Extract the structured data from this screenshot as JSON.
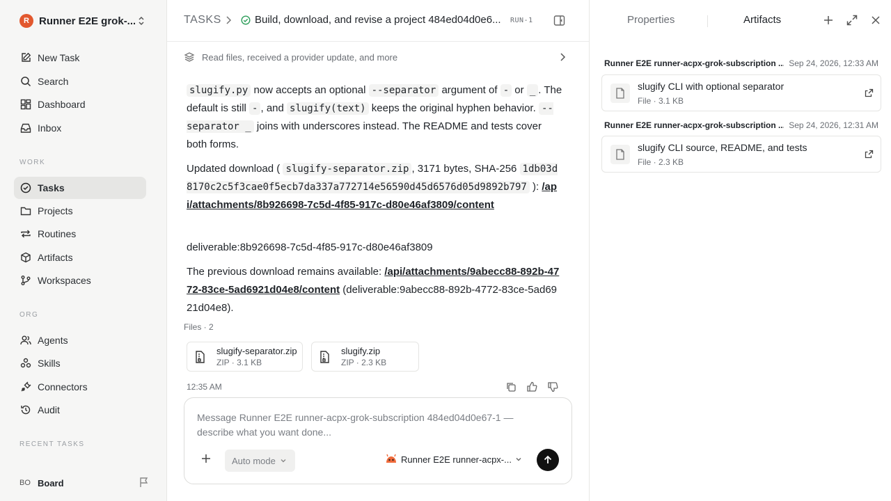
{
  "sidebar": {
    "workspace": {
      "initial": "R",
      "name": "Runner E2E grok-..."
    },
    "nav": [
      {
        "label": "New Task",
        "icon": "edit-icon"
      },
      {
        "label": "Search",
        "icon": "search-icon"
      },
      {
        "label": "Dashboard",
        "icon": "dashboard-icon"
      },
      {
        "label": "Inbox",
        "icon": "inbox-icon"
      }
    ],
    "work_label": "WORK",
    "work": [
      {
        "label": "Tasks",
        "icon": "check-circle-icon",
        "active": true
      },
      {
        "label": "Projects",
        "icon": "folder-icon"
      },
      {
        "label": "Routines",
        "icon": "repeat-icon"
      },
      {
        "label": "Artifacts",
        "icon": "cube-icon"
      },
      {
        "label": "Workspaces",
        "icon": "git-branch-icon"
      }
    ],
    "org_label": "ORG",
    "org": [
      {
        "label": "Agents",
        "icon": "users-icon"
      },
      {
        "label": "Skills",
        "icon": "skills-icon"
      },
      {
        "label": "Connectors",
        "icon": "plug-icon"
      },
      {
        "label": "Audit",
        "icon": "history-icon"
      }
    ],
    "recent_label": "RECENT TASKS",
    "board": {
      "avatar": "BO",
      "name": "Board"
    }
  },
  "header": {
    "root": "TASKS",
    "title": "Build, download, and revise a project 484ed04d0e6...",
    "run": "RUN-1"
  },
  "activity": {
    "text": "Read files, received a provider update, and more"
  },
  "message": {
    "p1": {
      "code1": "slugify.py",
      "t1": " now accepts an optional ",
      "code2": "--separator",
      "t2": " argument of ",
      "code3": "-",
      "t3": " or ",
      "code4": "_",
      "t4": ". The default is still ",
      "code5": "-",
      "t5": ", and ",
      "code6": "slugify(text)",
      "t6": " keeps the original hyphen behavior. ",
      "code7": "--separator _",
      "t7": " joins with underscores instead. The README and tests cover both forms."
    },
    "p2": {
      "t1": "Updated download ( ",
      "code1": "slugify-separator.zip",
      "t2": ", 3171 bytes, SHA-256 ",
      "code2": "1db03d8170c2c5f3cae0f5ecb7da337a772714e56590d45d6576d05d9892b797",
      "t3": " ): ",
      "link": "/api/attachments/8b926698-7c5d-4f85-917c-d80e46af3809/content"
    },
    "p3": "deliverable:8b926698-7c5d-4f85-917c-d80e46af3809",
    "p4": {
      "t1": "The previous download remains available: ",
      "link": "/api/attachments/9abecc88-892b-4772-83ce-5ad6921d04e8/content",
      "t2": " (deliverable:9abecc88-892b-4772-83ce-5ad6921d04e8)."
    },
    "files_label": "Files · 2",
    "files": [
      {
        "name": "slugify-separator.zip",
        "meta": "ZIP · 3.1 KB"
      },
      {
        "name": "slugify.zip",
        "meta": "ZIP · 2.3 KB"
      }
    ],
    "time": "12:35 AM"
  },
  "composer": {
    "placeholder": "Message Runner E2E runner-acpx-grok-subscription 484ed04d0e67-1 — describe what you want done...",
    "mode": "Auto mode",
    "agent": "Runner E2E runner-acpx-..."
  },
  "right_panel": {
    "tabs": {
      "properties": "Properties",
      "artifacts": "Artifacts"
    },
    "groups": [
      {
        "name": "Runner E2E runner-acpx-grok-subscription ...",
        "date": "Sep 24, 2026, 12:33 AM",
        "artifact": {
          "title": "slugify CLI with optional separator",
          "meta": "File · 3.1 KB"
        }
      },
      {
        "name": "Runner E2E runner-acpx-grok-subscription ...",
        "date": "Sep 24, 2026, 12:31 AM",
        "artifact": {
          "title": "slugify CLI source, README, and tests",
          "meta": "File · 2.3 KB"
        }
      }
    ]
  }
}
